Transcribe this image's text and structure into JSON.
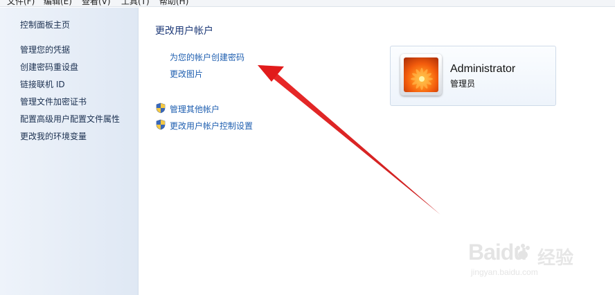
{
  "menubar": {
    "items": [
      "文件(F)",
      "编辑(E)",
      "查看(V)",
      "工具(T)",
      "帮助(H)"
    ]
  },
  "sidebar": {
    "home": "控制面板主页",
    "items": [
      "管理您的凭据",
      "创建密码重设盘",
      "链接联机 ID",
      "管理文件加密证书",
      "配置高级用户配置文件属性",
      "更改我的环境变量"
    ]
  },
  "main": {
    "title": "更改用户帐户",
    "links": [
      "为您的帐户创建密码",
      "更改图片"
    ],
    "shield_links": [
      "管理其他帐户",
      "更改用户帐户控制设置"
    ]
  },
  "account": {
    "name": "Administrator",
    "role": "管理员"
  },
  "watermark": {
    "brand": "Baidu",
    "sub": "经验",
    "url": "jingyan.baidu.com"
  },
  "colors": {
    "link": "#1f5fb0",
    "title": "#1e3a78",
    "arrow": "#e11b1b"
  }
}
